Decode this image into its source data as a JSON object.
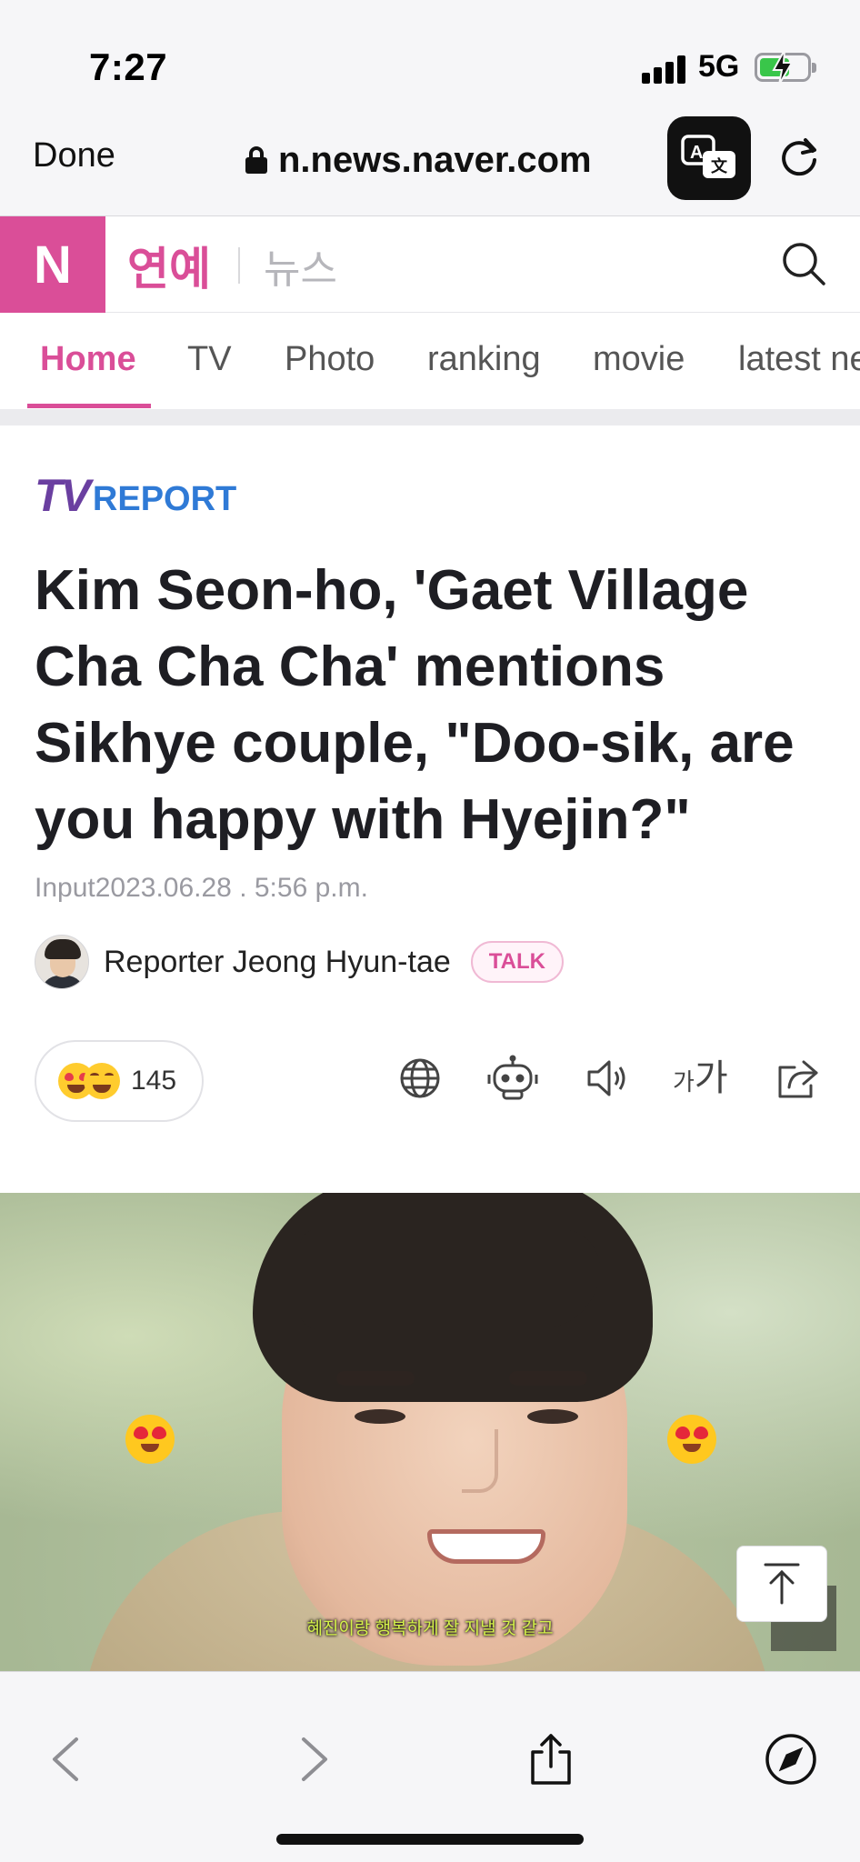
{
  "status_bar": {
    "time": "7:27",
    "network": "5G"
  },
  "browser": {
    "done_label": "Done",
    "url": "n.news.naver.com",
    "translate_icon": "translate-icon",
    "reload_icon": "reload-icon"
  },
  "site_header": {
    "logo_letter": "N",
    "section": "연예",
    "subsection": "뉴스",
    "search_icon": "search-icon",
    "brand_color": "#da4e98"
  },
  "tabs": [
    {
      "label": "Home",
      "active": true
    },
    {
      "label": "TV"
    },
    {
      "label": "Photo"
    },
    {
      "label": "ranking"
    },
    {
      "label": "movie"
    },
    {
      "label": "latest news"
    }
  ],
  "article": {
    "press": {
      "part1": "TV",
      "part2": "REPORT"
    },
    "headline": "Kim Seon-ho, 'Gaet Village Cha Cha Cha' mentions Sikhye couple, \"Doo-sik, are you happy with Hyejin?\"",
    "input_date": "Input2023.06.28 . 5:56 p.m.",
    "reporter": "Reporter Jeong Hyun-tae",
    "talk_label": "TALK",
    "reaction_count": "145",
    "font_size_label_small": "가",
    "font_size_label_large": "가",
    "photo_caption": "혜진이랑 행복하게 잘 지낼 것 같고"
  },
  "toolbar_icons": [
    "back-icon",
    "forward-icon",
    "share-icon",
    "compass-icon"
  ]
}
